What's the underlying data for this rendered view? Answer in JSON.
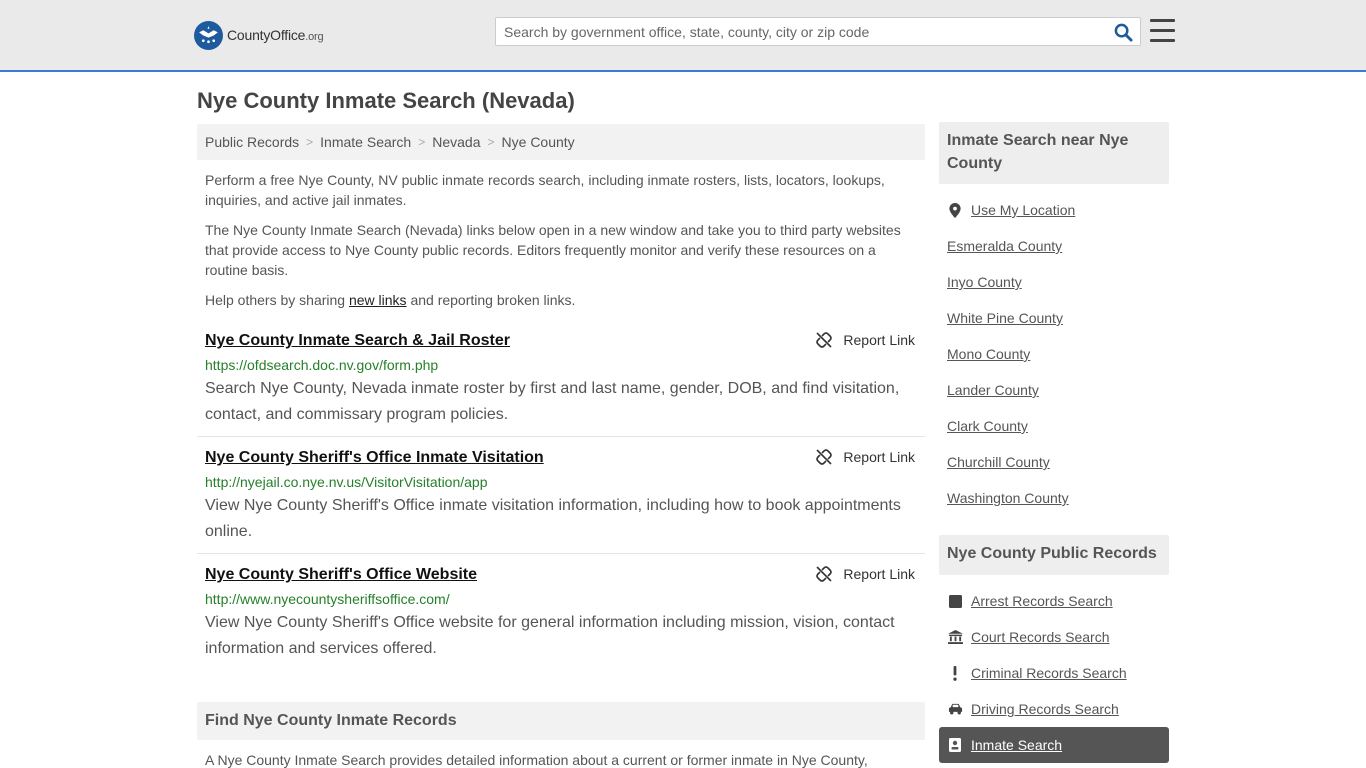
{
  "header": {
    "logo_main": "CountyOffice",
    "logo_tld": ".org",
    "search_placeholder": "Search by government office, state, county, city or zip code"
  },
  "page": {
    "title": "Nye County Inmate Search (Nevada)"
  },
  "breadcrumb": [
    {
      "label": "Public Records"
    },
    {
      "label": "Inmate Search"
    },
    {
      "label": "Nevada"
    },
    {
      "label": "Nye County"
    }
  ],
  "intro": {
    "p1": "Perform a free Nye County, NV public inmate records search, including inmate rosters, lists, locators, lookups, inquiries, and active jail inmates.",
    "p2": "The Nye County Inmate Search (Nevada) links below open in a new window and take you to third party websites that provide access to Nye County public records. Editors frequently monitor and verify these resources on a routine basis.",
    "p3_before": "Help others by sharing ",
    "p3_link": "new links",
    "p3_after": " and reporting broken links."
  },
  "report_label": "Report Link",
  "results": [
    {
      "title": "Nye County Inmate Search & Jail Roster",
      "url": "https://ofdsearch.doc.nv.gov/form.php",
      "desc": "Search Nye County, Nevada inmate roster by first and last name, gender, DOB, and find visitation, contact, and commissary program policies."
    },
    {
      "title": "Nye County Sheriff's Office Inmate Visitation",
      "url": "http://nyejail.co.nye.nv.us/VisitorVisitation/app",
      "desc": "View Nye County Sheriff's Office inmate visitation information, including how to book appointments online."
    },
    {
      "title": "Nye County Sheriff's Office Website",
      "url": "http://www.nyecountysheriffsoffice.com/",
      "desc": "View Nye County Sheriff's Office website for general information including mission, vision, contact information and services offered."
    }
  ],
  "find_section": {
    "title": "Find Nye County Inmate Records",
    "text": "A Nye County Inmate Search provides detailed information about a current or former inmate in Nye County,"
  },
  "sidebar": {
    "nearby_title": "Inmate Search near Nye County",
    "use_location": "Use My Location",
    "nearby": [
      "Esmeralda County",
      "Inyo County",
      "White Pine County",
      "Mono County",
      "Lander County",
      "Clark County",
      "Churchill County",
      "Washington County"
    ],
    "records_title": "Nye County Public Records",
    "records": [
      {
        "label": "Arrest Records Search",
        "icon": "square-icon"
      },
      {
        "label": "Court Records Search",
        "icon": "courthouse-icon"
      },
      {
        "label": "Criminal Records Search",
        "icon": "exclamation-icon"
      },
      {
        "label": "Driving Records Search",
        "icon": "car-icon"
      },
      {
        "label": "Inmate Search",
        "icon": "id-badge-icon",
        "active": true
      }
    ]
  },
  "colors": {
    "accent_border": "#3a7bd5",
    "logo_blue": "#1e5a9e",
    "url_green": "#26802a",
    "active_bg": "#555555"
  }
}
